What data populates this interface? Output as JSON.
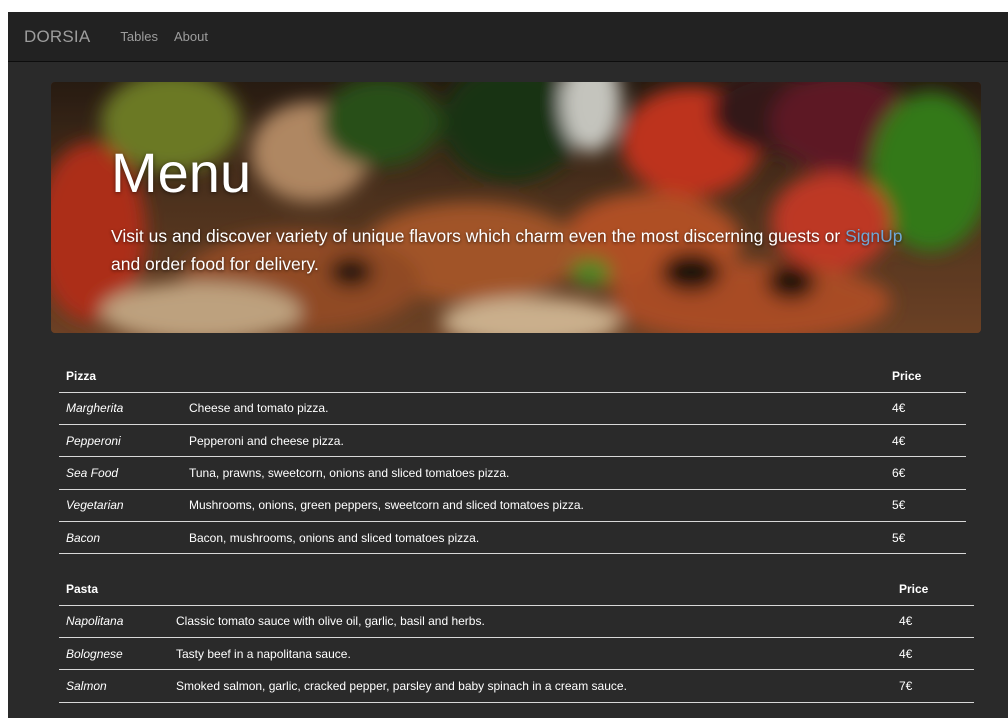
{
  "nav": {
    "brand": "DORSIA",
    "links": [
      "Tables",
      "About"
    ]
  },
  "hero": {
    "title": "Menu",
    "text_before": "Visit us and discover variety of unique flavors which charm even the most discerning guests or ",
    "link": "SignUp",
    "text_after": " and order food for delivery."
  },
  "pizza": {
    "header_name": "Pizza",
    "header_price": "Price",
    "items": [
      {
        "name": "Margherita",
        "description": "Cheese and tomato pizza.",
        "price": "4€"
      },
      {
        "name": "Pepperoni",
        "description": "Pepperoni and cheese pizza.",
        "price": "4€"
      },
      {
        "name": "Sea Food",
        "description": "Tuna, prawns, sweetcorn, onions and sliced tomatoes pizza.",
        "price": "6€"
      },
      {
        "name": "Vegetarian",
        "description": "Mushrooms, onions, green peppers, sweetcorn and sliced tomatoes pizza.",
        "price": "5€"
      },
      {
        "name": "Bacon",
        "description": "Bacon, mushrooms, onions and sliced tomatoes pizza.",
        "price": "5€"
      }
    ]
  },
  "pasta": {
    "header_name": "Pasta",
    "header_price": "Price",
    "items": [
      {
        "name": "Napolitana",
        "description": "Classic tomato sauce with olive oil, garlic, basil and herbs.",
        "price": "4€"
      },
      {
        "name": "Bolognese",
        "description": "Tasty beef in a napolitana sauce.",
        "price": "4€"
      },
      {
        "name": "Salmon",
        "description": "Smoked salmon, garlic, cracked pepper, parsley and baby spinach in a cream sauce.",
        "price": "7€"
      }
    ]
  },
  "colors": {
    "background": "#2a2a2a",
    "navbar": "#222222",
    "nav_text": "#9d9d9d",
    "link": "#6fa7d4",
    "text": "#ffffff"
  }
}
